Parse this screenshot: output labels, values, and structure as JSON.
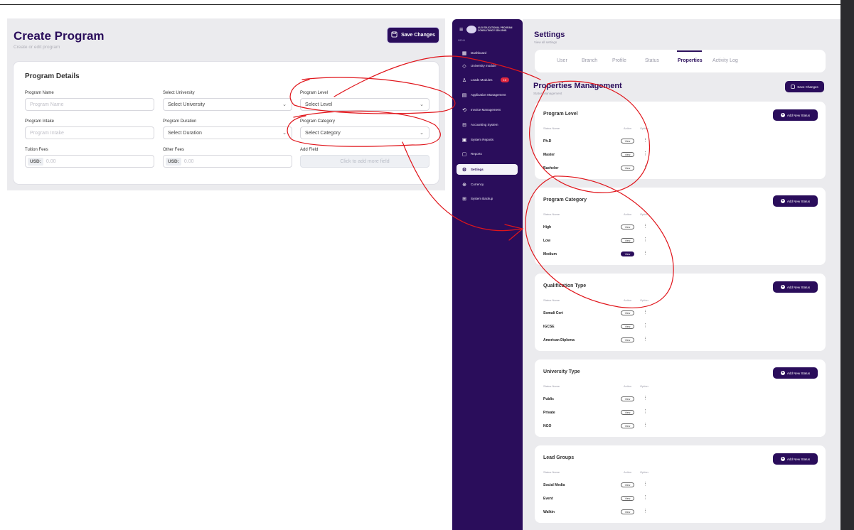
{
  "create_program": {
    "title": "Create Program",
    "subtitle": "Create or edit program",
    "save_label": "Save Changes",
    "card_title": "Program Details",
    "fields": {
      "program_name": {
        "label": "Program Name",
        "placeholder": "Program Name"
      },
      "select_university": {
        "label": "Select University",
        "value": "Select University"
      },
      "program_level": {
        "label": "Program Level",
        "value": "Select Level"
      },
      "program_intake": {
        "label": "Program Intake",
        "placeholder": "Program Intake"
      },
      "program_duration": {
        "label": "Program Duration",
        "value": "Select Duration"
      },
      "program_category": {
        "label": "Program Category",
        "value": "Select Category"
      },
      "tuition_fees": {
        "label": "Tuition Fees",
        "prefix": "USD:",
        "placeholder": "0.00"
      },
      "other_fees": {
        "label": "Other Fees",
        "prefix": "USD:",
        "placeholder": "0.00"
      },
      "add_field": {
        "label": "Add Field",
        "button": "Click to add more field"
      }
    }
  },
  "sidebar": {
    "brand": "AUO EDUCATIONAL PROGRAM CONSULTANCY SDN. BHD.",
    "menu_label": "MENU",
    "items": [
      {
        "label": "Dashboard",
        "icon": "grid-icon"
      },
      {
        "label": "University module",
        "icon": "graduation-icon"
      },
      {
        "label": "Leads Modules",
        "icon": "users-icon",
        "badge": "10"
      },
      {
        "label": "Application Management",
        "icon": "document-icon"
      },
      {
        "label": "Invoice Management",
        "icon": "invoice-icon"
      },
      {
        "label": "Accounting System",
        "icon": "accounting-icon"
      },
      {
        "label": "System Reports",
        "icon": "report-icon"
      },
      {
        "label": "Reports",
        "icon": "chart-icon"
      },
      {
        "label": "Settings",
        "icon": "gear-icon",
        "active": true
      },
      {
        "label": "Currency",
        "icon": "globe-icon"
      },
      {
        "label": "System Backup",
        "icon": "backup-icon"
      }
    ]
  },
  "settings": {
    "title": "Settings",
    "subtitle": "View all settings",
    "tabs": [
      "User",
      "Branch",
      "Profile",
      "Status",
      "Properties",
      "Activity Log"
    ],
    "active_tab": "Properties",
    "section_title": "Properties Management",
    "section_subtitle": "Status Management",
    "save_label": "Save Changes",
    "col_status": "Status Name",
    "col_action": "Action",
    "col_option": "Option",
    "view_label": "View",
    "add_label": "Add New Status",
    "panels": [
      {
        "title": "Program Level",
        "rows": [
          "Ph.D",
          "Master",
          "Bachelor"
        ]
      },
      {
        "title": "Program Category",
        "rows": [
          "High",
          "Low",
          "Medium"
        ]
      },
      {
        "title": "Qualification Type",
        "rows": [
          "Somali Cert",
          "IGCSE",
          "American Diploma"
        ]
      },
      {
        "title": "University Type",
        "rows": [
          "Public",
          "Private",
          "NGO"
        ]
      },
      {
        "title": "Lead Groups",
        "rows": [
          "Social Media",
          "Event",
          "Walkin"
        ]
      }
    ]
  },
  "colors": {
    "primary": "#2a0d5b",
    "badge": "#e0293f",
    "annotation": "#e0151b"
  }
}
